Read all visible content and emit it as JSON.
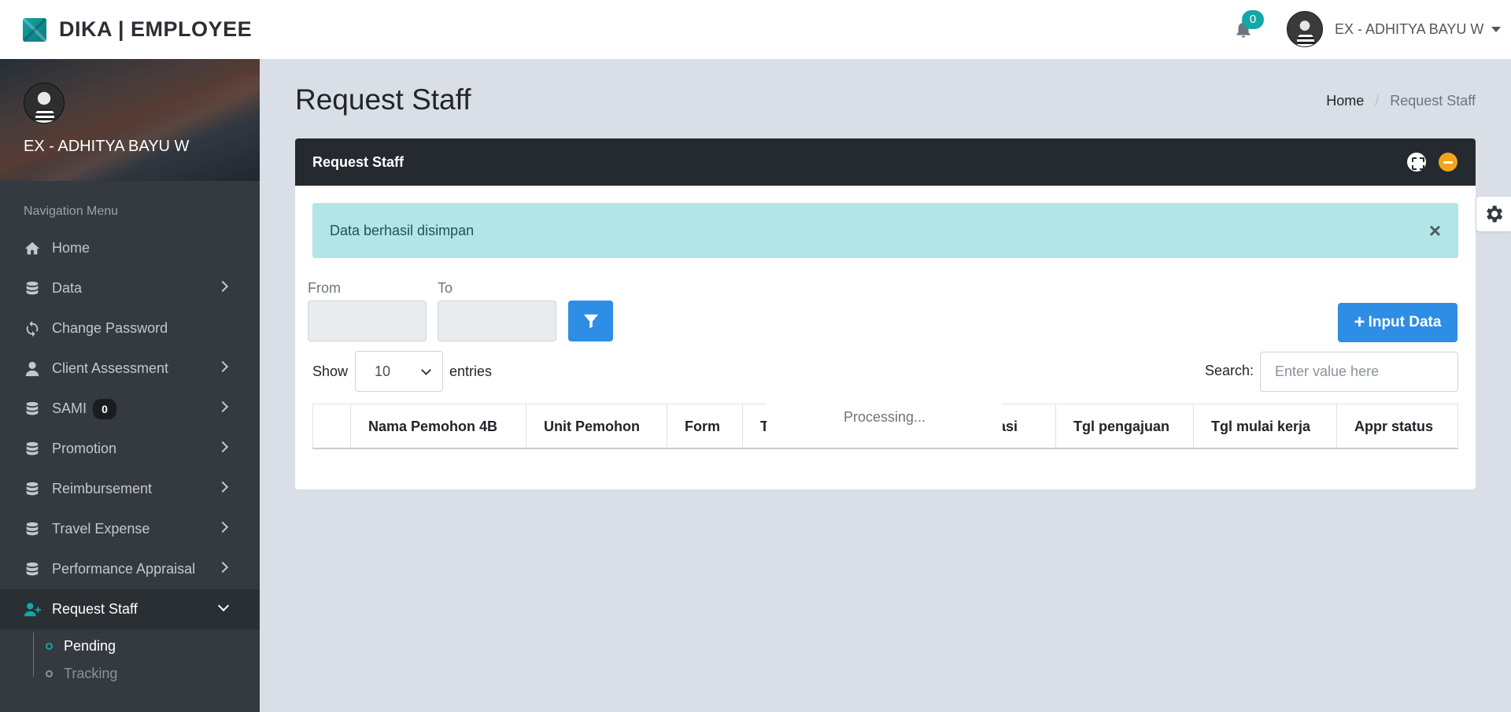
{
  "header": {
    "brand": "DIKA | EMPLOYEE",
    "notification_count": "0",
    "user_name": "EX - ADHITYA BAYU W"
  },
  "sidebar": {
    "profile_name": "EX - ADHITYA BAYU W",
    "nav_header": "Navigation Menu",
    "items": [
      {
        "label": "Home",
        "icon": "home-icon"
      },
      {
        "label": "Data",
        "icon": "database-icon"
      },
      {
        "label": "Change Password",
        "icon": "sync-icon"
      },
      {
        "label": "Client Assessment",
        "icon": "user-icon"
      },
      {
        "label": "SAMI",
        "icon": "database-icon",
        "badge": "0"
      },
      {
        "label": "Promotion",
        "icon": "database-icon"
      },
      {
        "label": "Reimbursement",
        "icon": "database-icon"
      },
      {
        "label": "Travel Expense",
        "icon": "database-icon"
      },
      {
        "label": "Performance Appraisal",
        "icon": "database-icon"
      },
      {
        "label": "Request Staff",
        "icon": "user-plus-icon",
        "active": true
      }
    ],
    "subitems": [
      {
        "label": "Pending",
        "active": true
      },
      {
        "label": "Tracking"
      }
    ]
  },
  "page": {
    "title": "Request Staff",
    "breadcrumb": {
      "home": "Home",
      "current": "Request Staff"
    }
  },
  "card": {
    "title": "Request Staff",
    "alert": "Data berhasil disimpan",
    "alert_close": "×",
    "filter": {
      "from_label": "From",
      "to_label": "To"
    },
    "input_button": "Input Data",
    "show_label": "Show",
    "entries_value": "10",
    "entries_label": "entries",
    "search_label": "Search:",
    "search_placeholder": "Enter value here",
    "processing": "Processing...",
    "columns": [
      "",
      "Nama Pemohon 4B",
      "Unit Pemohon",
      "Form",
      "T",
      "",
      "Lokasi",
      "Tgl pengajuan",
      "Tgl mulai kerja",
      "Appr status"
    ]
  },
  "colors": {
    "accent": "#12a7a8",
    "primary": "#2e8de4",
    "sidebar_bg": "#343a40",
    "card_header_bg": "#252a30",
    "alert_bg": "#b2e5e5",
    "minimize": "#f1a41c"
  }
}
